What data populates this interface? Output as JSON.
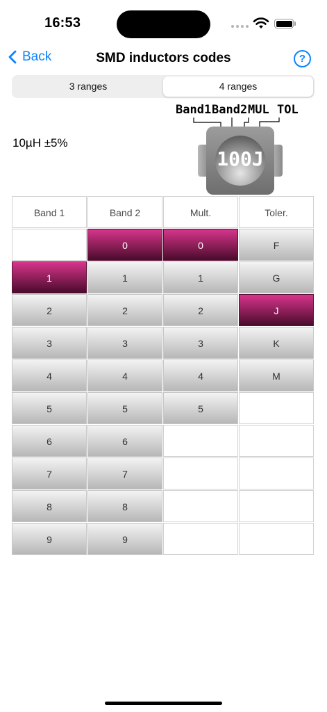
{
  "status": {
    "time": "16:53"
  },
  "nav": {
    "back_label": "Back",
    "title": "SMD inductors codes",
    "help_symbol": "?"
  },
  "segments": [
    "3 ranges",
    "4 ranges"
  ],
  "selected_segment": "4 ranges",
  "value_text": "10µH ±5%",
  "diagram": {
    "labels": [
      "Band1",
      "Band2",
      "MUL",
      "TOL"
    ],
    "code": "100J"
  },
  "table": {
    "headers": [
      "Band 1",
      "Band 2",
      "Mult.",
      "Toler."
    ],
    "columns": [
      [
        "",
        "1",
        "2",
        "3",
        "4",
        "5",
        "6",
        "7",
        "8",
        "9"
      ],
      [
        "0",
        "1",
        "2",
        "3",
        "4",
        "5",
        "6",
        "7",
        "8",
        "9"
      ],
      [
        "0",
        "1",
        "2",
        "3",
        "4",
        "5",
        "",
        "",
        "",
        ""
      ],
      [
        "F",
        "G",
        "J",
        "K",
        "M",
        "",
        "",
        "",
        "",
        ""
      ]
    ],
    "selected": [
      "1",
      "0",
      "0",
      "J"
    ]
  },
  "colors": {
    "accent": "#0a84ff",
    "selected_top": "#d6358b",
    "selected_bottom": "#4a0b2b"
  }
}
